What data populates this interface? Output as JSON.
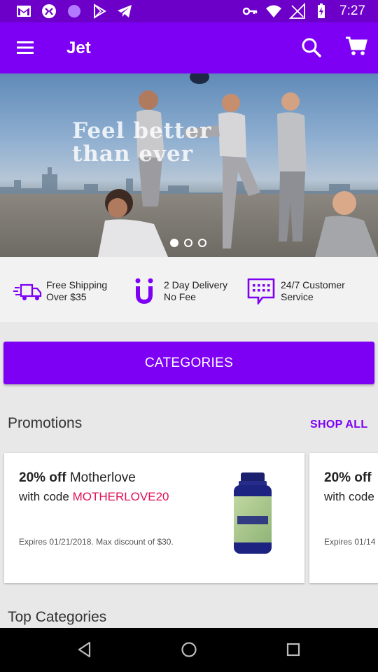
{
  "status_bar": {
    "time": "7:27",
    "left_icons": [
      "gmail-icon",
      "hands-icon",
      "circle-icon",
      "play-store-icon",
      "telegram-icon"
    ],
    "right_icons": [
      "key-icon",
      "wifi-icon",
      "no-signal-icon",
      "battery-charging-icon"
    ]
  },
  "app_bar": {
    "title": "Jet",
    "menu_icon": "menu-icon",
    "search_icon": "search-icon",
    "cart_icon": "cart-icon",
    "color": "#7d00f5"
  },
  "hero": {
    "headline_line1": "Feel better",
    "headline_line2": "than ever",
    "slide_count": 3,
    "active_slide": 1
  },
  "features": [
    {
      "icon": "truck-icon",
      "line1": "Free Shipping",
      "line2": "Over $35"
    },
    {
      "icon": "jet-j-icon",
      "line1": "2 Day Delivery",
      "line2": "No Fee"
    },
    {
      "icon": "chat-icon",
      "line1": "24/7 Customer",
      "line2": "Service"
    }
  ],
  "categories_button": "CATEGORIES",
  "promotions": {
    "title": "Promotions",
    "shop_all": "SHOP ALL",
    "cards": [
      {
        "discount": "20% off",
        "brand": "Motherlove",
        "with_code": "with code",
        "code": "MOTHERLOVE20",
        "expires": "Expires 01/21/2018. Max discount of $30.",
        "product_image": "supplement-bottle"
      },
      {
        "discount": "20% off",
        "with_code": "with code",
        "expires": "Expires 01/14"
      }
    ]
  },
  "top_categories": {
    "title": "Top Categories"
  },
  "nav_bar": [
    "back-icon",
    "home-icon",
    "recents-icon"
  ]
}
